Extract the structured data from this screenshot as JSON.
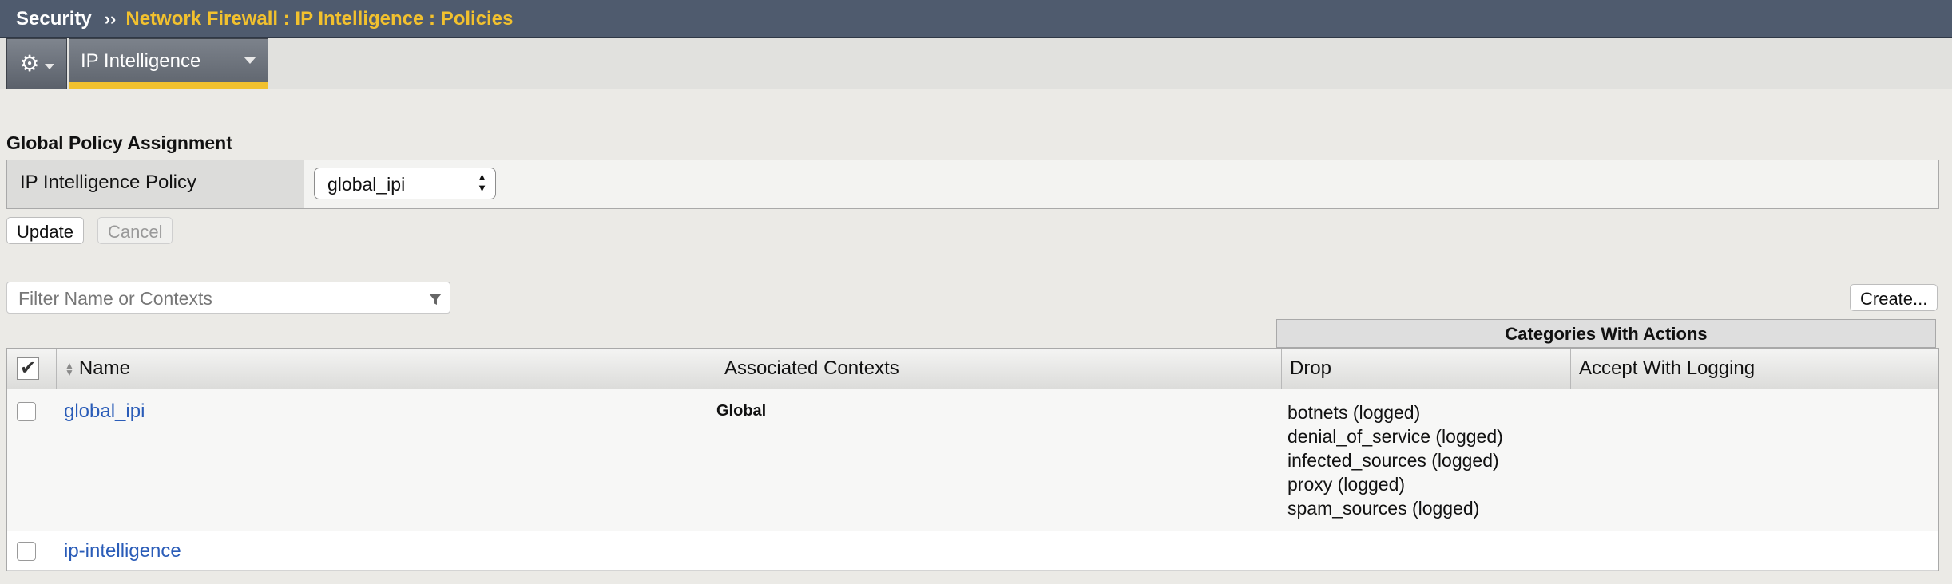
{
  "breadcrumb": {
    "section": "Security",
    "separator": "››",
    "path": "Network Firewall : IP Intelligence : Policies"
  },
  "menu": {
    "gear_icon": "gear-icon",
    "tab_label": "IP Intelligence",
    "accent_color": "#f2c12e"
  },
  "global_policy": {
    "title": "Global Policy Assignment",
    "field_label": "IP Intelligence Policy",
    "selected_value": "global_ipi",
    "update_label": "Update",
    "cancel_label": "Cancel"
  },
  "filter": {
    "placeholder": "Filter Name or Contexts",
    "create_label": "Create..."
  },
  "table": {
    "group_header": "Categories With Actions",
    "columns": {
      "name": "Name",
      "contexts": "Associated Contexts",
      "drop": "Drop",
      "accept": "Accept With Logging"
    },
    "rows": [
      {
        "name": "global_ipi",
        "contexts": "Global",
        "drop": [
          "botnets (logged)",
          "denial_of_service (logged)",
          "infected_sources (logged)",
          "proxy (logged)",
          "spam_sources (logged)"
        ],
        "accept": ""
      },
      {
        "name": "ip-intelligence",
        "contexts": "",
        "drop": [],
        "accept": ""
      }
    ]
  }
}
